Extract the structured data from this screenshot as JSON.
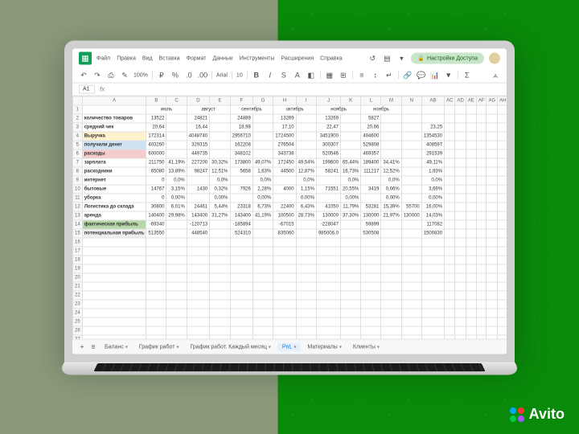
{
  "menu": {
    "file": "Файл",
    "edit": "Правка",
    "view": "Вид",
    "insert": "Вставка",
    "format": "Формат",
    "data": "Данные",
    "tools": "Инструменты",
    "ext": "Расширения",
    "help": "Справка"
  },
  "share": "Настройки Доступа",
  "zoom": "100%",
  "font": "Arial",
  "fontsize": "10",
  "cellref": "A1",
  "months": [
    "июль",
    "август",
    "сентябрь",
    "октябрь",
    "ноябрь",
    "ноябрь"
  ],
  "rows": [
    {
      "cls": "",
      "label": "количество товаров",
      "v": [
        "13522",
        "",
        "24821",
        "",
        "24889",
        "",
        "13269",
        "",
        "13269",
        "",
        "5827",
        ""
      ]
    },
    {
      "cls": "",
      "label": "средний чек",
      "v": [
        "20,64",
        "",
        "16,44",
        "",
        "18,98",
        "",
        "17,10",
        "",
        "22,47",
        "",
        "20,66",
        "",
        "",
        "23,25"
      ]
    },
    {
      "cls": "r-yellow",
      "label": "Выручка",
      "v": [
        "172314",
        "",
        "4048740",
        "",
        "2956710",
        "",
        "1724500",
        "",
        "3451900",
        "",
        "494600",
        "",
        "",
        "1354530"
      ]
    },
    {
      "cls": "r-blue",
      "label": "получили денег",
      "v": [
        "403260",
        "",
        "329315",
        "",
        "162208",
        "",
        "276504",
        "",
        "300307",
        "",
        "529808",
        "",
        "",
        "408597"
      ]
    },
    {
      "cls": "r-pink",
      "label": "расходы",
      "v": [
        "600000",
        "",
        "449735",
        "",
        "348102",
        "",
        "343738",
        "",
        "520546",
        "",
        "469357",
        "",
        "",
        "291539"
      ]
    },
    {
      "cls": "",
      "label": "зарплата",
      "v": [
        "211750",
        "41,19%",
        "227200",
        "30,32%",
        "173800",
        "49,07%",
        "172450",
        "49,54%",
        "199600",
        "65,44%",
        "189400",
        "34,41%",
        "",
        "49,11%"
      ]
    },
    {
      "cls": "",
      "label": "расходники",
      "v": [
        "65080",
        "13,89%",
        "98247",
        "12,51%",
        "5658",
        "1,63%",
        "44500",
        "12,87%",
        "58241",
        "16,73%",
        "111217",
        "12,52%",
        "",
        "1,93%"
      ]
    },
    {
      "cls": "",
      "label": "интернет",
      "v": [
        "0",
        "0,0%",
        "",
        "0,0%",
        "",
        "0,0%",
        "",
        "0,0%",
        "",
        "0,0%",
        "",
        "0,0%",
        "",
        "0,0%"
      ]
    },
    {
      "cls": "",
      "label": "бытовые",
      "v": [
        "14767",
        "3,15%",
        "1430",
        "0,32%",
        "7926",
        "2,28%",
        "4000",
        "1,15%",
        "71551",
        "20,55%",
        "3419",
        "0,66%",
        "",
        "3,69%"
      ]
    },
    {
      "cls": "",
      "label": "уборка",
      "v": [
        "0",
        "0,00%",
        "",
        "0,00%",
        "",
        "0,00%",
        "",
        "0,00%",
        "",
        "0,00%",
        "",
        "0,00%",
        "",
        "0,00%"
      ]
    },
    {
      "cls": "",
      "label": "Логистика до склада",
      "v": [
        "30800",
        "6,01%",
        "24461",
        "5,44%",
        "23318",
        "6,73%",
        "22400",
        "6,43%",
        "41050",
        "11,79%",
        "53281",
        "15,39%",
        "55700",
        "16,00%"
      ]
    },
    {
      "cls": "",
      "label": "аренда",
      "v": [
        "140400",
        "29,98%",
        "143400",
        "31,27%",
        "143400",
        "41,19%",
        "100500",
        "28,73%",
        "130000",
        "37,30%",
        "130000",
        "21,97%",
        "130000",
        "14,03%"
      ]
    },
    {
      "cls": "r-dgreen",
      "label": "фактическая прибыль",
      "v": [
        "-69340",
        "",
        "-120713",
        "",
        "-185894",
        "",
        "-67015",
        "",
        "-228047",
        "",
        "59899",
        "",
        "",
        "117082"
      ]
    },
    {
      "cls": "r-gray",
      "label": "потенциальная прибыль",
      "v": [
        "513550",
        "",
        "448540",
        "",
        "524310",
        "",
        "835060",
        "",
        "985006,0",
        "",
        "530508",
        "",
        "",
        "1500830"
      ]
    }
  ],
  "tabs": {
    "t1": "Баланс",
    "t2": "График работ",
    "t3": "График работ. Каждый месяц",
    "t4": "PnL",
    "t5": "Материалы",
    "t6": "Клиенты"
  },
  "avito": "Avito"
}
